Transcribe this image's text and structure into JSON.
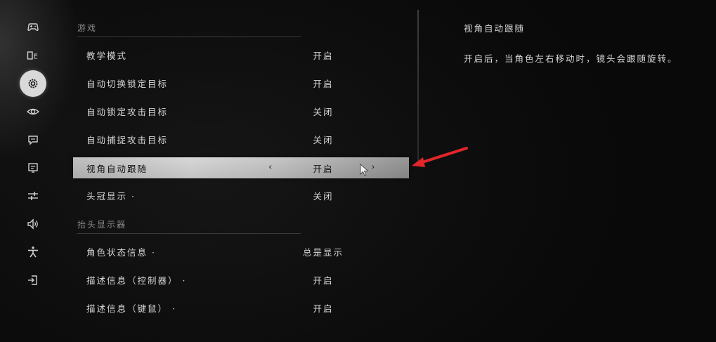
{
  "sidebar": {
    "items": [
      {
        "icon": "gamepad-icon"
      },
      {
        "icon": "language-icon"
      },
      {
        "icon": "gear-icon",
        "active": true
      },
      {
        "icon": "eye-icon"
      },
      {
        "icon": "subtitles-icon"
      },
      {
        "icon": "display-icon"
      },
      {
        "icon": "sliders-icon"
      },
      {
        "icon": "speaker-icon"
      },
      {
        "icon": "accessibility-icon"
      },
      {
        "icon": "exit-icon"
      }
    ]
  },
  "sections": {
    "game": {
      "title": "游戏",
      "rows": [
        {
          "label": "教学模式",
          "value": "开启"
        },
        {
          "label": "自动切换锁定目标",
          "value": "开启"
        },
        {
          "label": "自动锁定攻击目标",
          "value": "关闭"
        },
        {
          "label": "自动捕捉攻击目标",
          "value": "关闭"
        },
        {
          "label": "视角自动跟随",
          "value": "开启",
          "selected": true
        },
        {
          "label": "头冠显示 ·",
          "value": "关闭"
        }
      ]
    },
    "hud": {
      "title": "抬头显示器",
      "rows": [
        {
          "label": "角色状态信息 ·",
          "value": "总是显示"
        },
        {
          "label": "描述信息（控制器） ·",
          "value": "开启"
        },
        {
          "label": "描述信息（键鼠） ·",
          "value": "开启"
        }
      ]
    }
  },
  "selector": {
    "left_arrow": "‹",
    "right_arrow": "›"
  },
  "description": {
    "title": "视角自动跟随",
    "text": "开启后，当角色左右移动时，镜头会跟随旋转。"
  },
  "colors": {
    "annotation_arrow": "#e0262b",
    "selected_row": "#c8c8c8"
  }
}
